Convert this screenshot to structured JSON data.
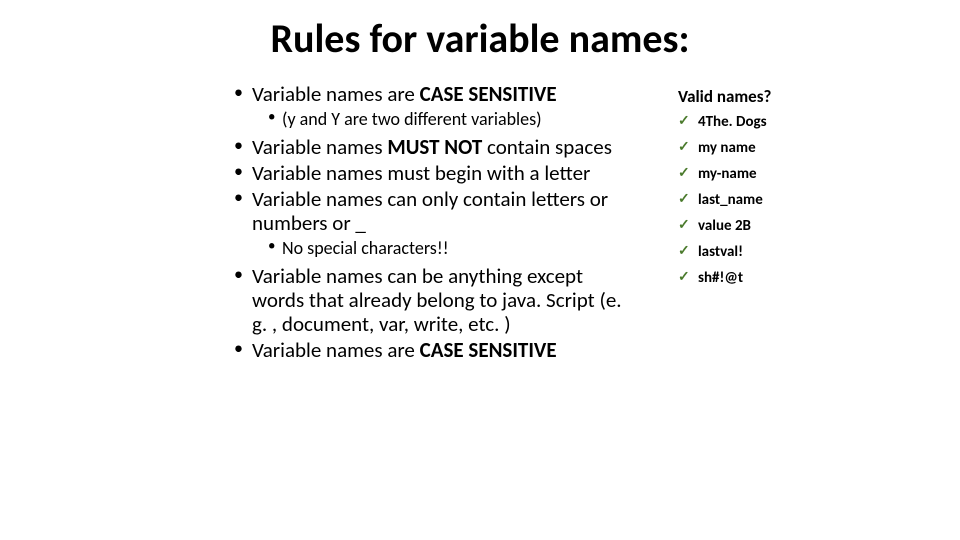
{
  "title": "Rules for variable names:",
  "rules": {
    "r1_pre": "Variable names are ",
    "r1_bold": "CASE SENSITIVE",
    "r1_sub": "(y and Y are two different variables)",
    "r2_pre": "Variable names ",
    "r2_bold": "MUST NOT ",
    "r2_post": "contain spaces",
    "r3": "Variable names must begin with a letter",
    "r4": "Variable names can only contain letters or numbers or _",
    "r4_sub": "No special characters!!",
    "r5": "Variable names can be anything except words that already belong to java. Script (e. g. , document, var, write, etc. )",
    "r6_pre": "Variable names are ",
    "r6_bold": "CASE SENSITIVE"
  },
  "sidebar": {
    "heading": "Valid names?",
    "items": [
      "4The. Dogs",
      "my name",
      "my-name",
      "last_name",
      "value 2B",
      "lastval!",
      "sh#!@t"
    ]
  }
}
